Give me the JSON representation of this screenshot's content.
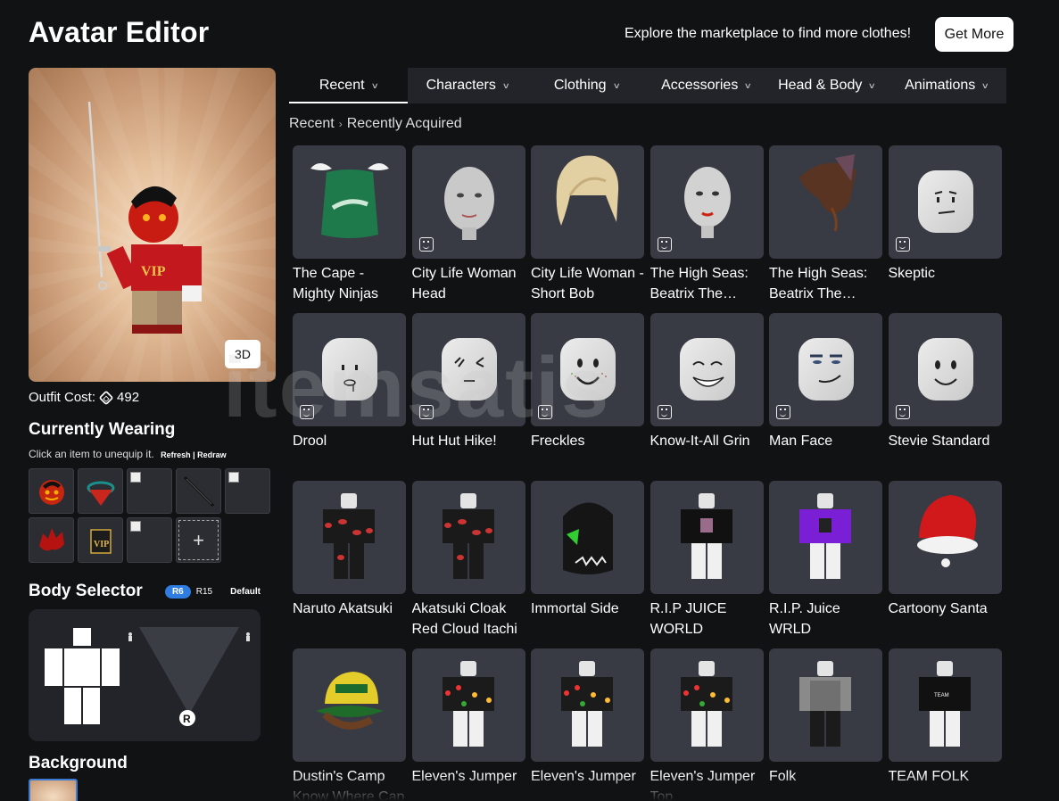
{
  "header": {
    "title": "Avatar Editor",
    "promo_text": "Explore the marketplace to find more clothes!",
    "get_more_label": "Get More"
  },
  "preview": {
    "btn_3d_label": "3D",
    "outfit_cost_label": "Outfit Cost:",
    "outfit_cost_value": "492"
  },
  "wearing": {
    "title": "Currently Wearing",
    "hint": "Click an item to unequip it.",
    "refresh_label": "Refresh | Redraw",
    "add_label": "+"
  },
  "body_selector": {
    "title": "Body Selector",
    "r6_label": "R6",
    "r15_label": "R15",
    "default_label": "Default"
  },
  "background": {
    "title": "Background"
  },
  "tabs": [
    {
      "label": "Recent",
      "active": true
    },
    {
      "label": "Characters",
      "active": false
    },
    {
      "label": "Clothing",
      "active": false
    },
    {
      "label": "Accessories",
      "active": false
    },
    {
      "label": "Head & Body",
      "active": false
    },
    {
      "label": "Animations",
      "active": false
    }
  ],
  "breadcrumb": {
    "root": "Recent",
    "current": "Recently Acquired"
  },
  "items": [
    {
      "name": "The Cape - Mighty Ninjas",
      "icon": "cape",
      "face": false
    },
    {
      "name": "City Life Woman Head",
      "icon": "head-woman",
      "face": true
    },
    {
      "name": "City Life Woman - Short Bob",
      "icon": "hair-bob",
      "face": false
    },
    {
      "name": "The High Seas: Beatrix The Pirate Queen Head",
      "icon": "head-pirate",
      "face": true
    },
    {
      "name": "The High Seas: Beatrix The Pirate Queen Hat",
      "icon": "pirate-hat",
      "face": false
    },
    {
      "name": "Skeptic",
      "icon": "face-skeptic",
      "face": true
    },
    {
      "name": "Drool",
      "icon": "face-drool",
      "face": true
    },
    {
      "name": "Hut Hut Hike!",
      "icon": "face-hut",
      "face": true
    },
    {
      "name": "Freckles",
      "icon": "face-freckles",
      "face": true
    },
    {
      "name": "Know-It-All Grin",
      "icon": "face-grin",
      "face": true
    },
    {
      "name": "Man Face",
      "icon": "face-man",
      "face": true
    },
    {
      "name": "Stevie Standard",
      "icon": "face-stevie",
      "face": true
    },
    {
      "name": "Naruto Akatsuki",
      "icon": "outfit-akatsuki",
      "face": false
    },
    {
      "name": "Akatsuki Cloak Red Cloud Itachi",
      "icon": "outfit-akatsuki",
      "face": false
    },
    {
      "name": "Immortal Side",
      "icon": "head-immortal",
      "face": false
    },
    {
      "name": "R.I.P JUICE WORLD",
      "icon": "outfit-black",
      "face": false
    },
    {
      "name": "R.I.P. Juice WRLD",
      "icon": "outfit-purple",
      "face": false
    },
    {
      "name": "Cartoony Santa",
      "icon": "santa-hat",
      "face": false
    },
    {
      "name": "Dustin's Camp Know Where Cap",
      "icon": "cap",
      "face": false
    },
    {
      "name": "Eleven's Jumper",
      "icon": "outfit-jumper",
      "face": false
    },
    {
      "name": "Eleven's Jumper",
      "icon": "outfit-jumper",
      "face": false
    },
    {
      "name": "Eleven's Jumper Top",
      "icon": "outfit-jumper",
      "face": false
    },
    {
      "name": "Folk",
      "icon": "outfit-folk",
      "face": false
    },
    {
      "name": "TEAM FOLK",
      "icon": "outfit-team",
      "face": false
    }
  ],
  "watermark": "itemsatis",
  "colors": {
    "background": "#111214",
    "tile": "#393b44",
    "accent_blue": "#2f7de1"
  }
}
